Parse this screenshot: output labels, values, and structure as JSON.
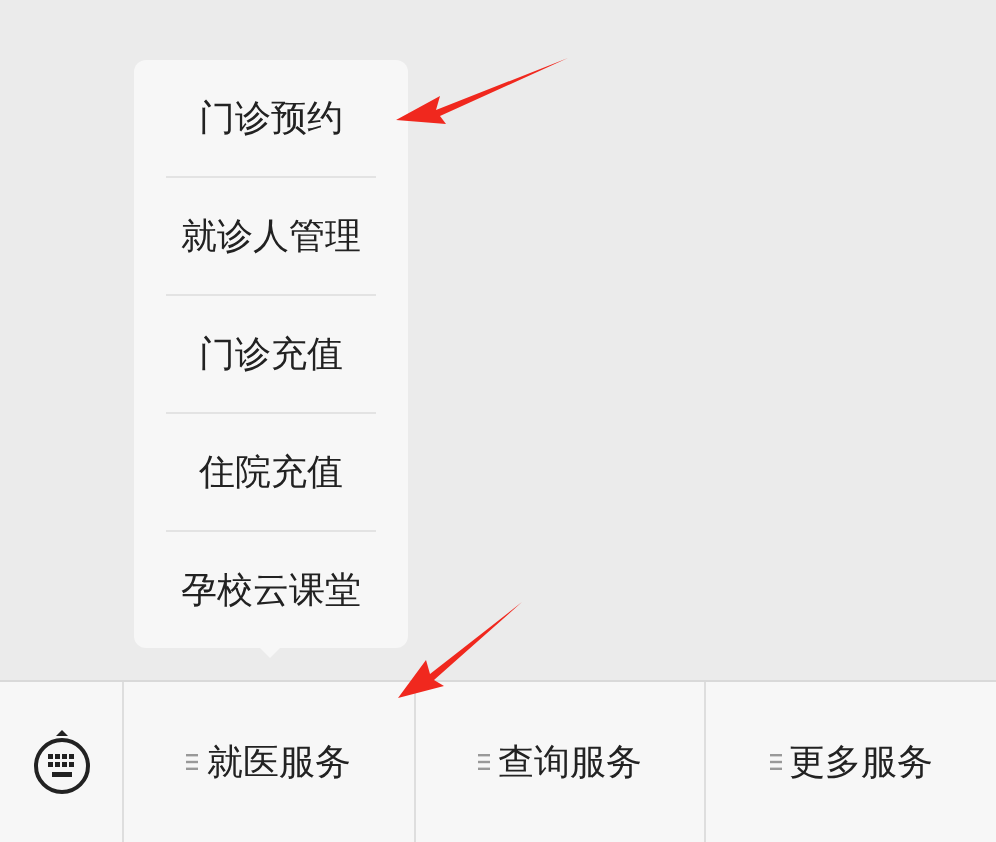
{
  "popup_menu": {
    "items": [
      "门诊预约",
      "就诊人管理",
      "门诊充值",
      "住院充值",
      "孕校云课堂"
    ]
  },
  "bottom_menu": {
    "items": [
      "就医服务",
      "查询服务",
      "更多服务"
    ]
  }
}
